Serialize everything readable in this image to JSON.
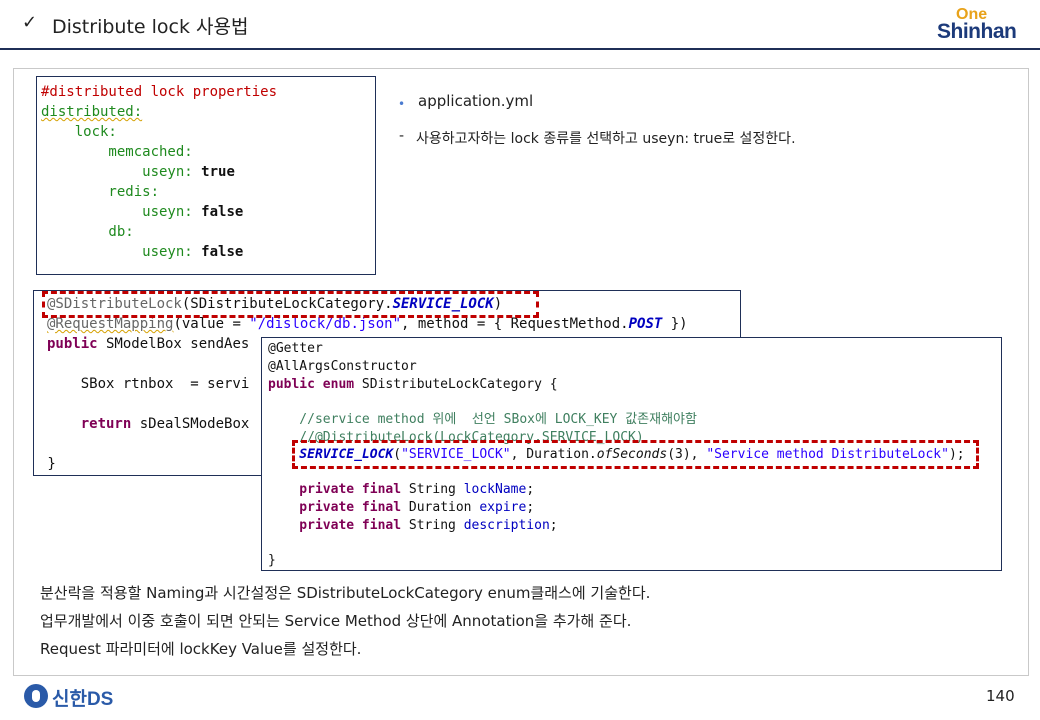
{
  "header": {
    "check": "✓",
    "title": "Distribute lock 사용법",
    "logo_top": "One",
    "logo_bottom": "Shinhan"
  },
  "yml": {
    "lines": [
      "#distributed lock properties",
      "distributed:",
      "    lock:",
      "        memcached:",
      "            useyn: ",
      "true",
      "        redis:",
      "            useyn: ",
      "false",
      "        db:",
      "            useyn: ",
      "false"
    ]
  },
  "notes": {
    "bullet": "application.yml",
    "dash": "-",
    "line": "사용하고자하는 lock 종류를 선택하고 useyn: true로 설정한다."
  },
  "controller": {
    "l1_ann": "@SDistributeLock",
    "l1_a": "(SDistributeLockCategory.",
    "l1_const": "SERVICE_LOCK",
    "l1_b": ")",
    "l2_ann": "@RequestMapping",
    "l2_a": "(value = ",
    "l2_str": "\"/dislock/db.json\"",
    "l2_b": ", method = { RequestMethod.",
    "l2_const": "POST",
    "l2_c": " })",
    "l3_kw": "public",
    "l3_a": " SModelBox sendAes",
    "l4": "    SBox rtnbox  = servi",
    "l5_kw": "    return",
    "l5_a": " sDealSModeBox",
    "l6": " }"
  },
  "enum": {
    "l1": "@Getter",
    "l2": "@AllArgsConstructor",
    "l3_kw": "public enum",
    "l3_a": " SDistributeLockCategory {",
    "l4": "    //service method 위에  선언 SBox에 LOCK_KEY 값존재해야함",
    "l5": "    //@DistributeLock(LockCategory.SERVICE_LOCK)",
    "l6_const": "    SERVICE_LOCK",
    "l6_a": "(",
    "l6_str1": "\"SERVICE_LOCK\"",
    "l6_b": ", Duration.",
    "l6_meth": "ofSeconds",
    "l6_c": "(3), ",
    "l6_str2": "\"Service method DistributeLock\"",
    "l6_d": ");",
    "f1_kw": "    private final",
    "f1_a": " String ",
    "f1_f": "lockName",
    "f2_kw": "    private final",
    "f2_a": " Duration ",
    "f2_f": "expire",
    "f3_kw": "    private final",
    "f3_a": " String ",
    "f3_f": "description",
    "semi": ";",
    "close": "}"
  },
  "descriptions": [
    "분산락을 적용할 Naming과 시간설정은 SDistributeLockCategory enum클래스에 기술한다.",
    "업무개발에서 이중 호출이 되면 안되는 Service Method 상단에 Annotation을 추가해 준다.",
    "Request 파라미터에 lockKey Value를 설정한다."
  ],
  "footer": {
    "brand": "신한DS",
    "page": "140"
  },
  "colors": {
    "navy": "#1f2f57",
    "highlight_red": "#c00000",
    "logo_orange": "#e8a21a",
    "logo_blue": "#1c3a7a"
  }
}
